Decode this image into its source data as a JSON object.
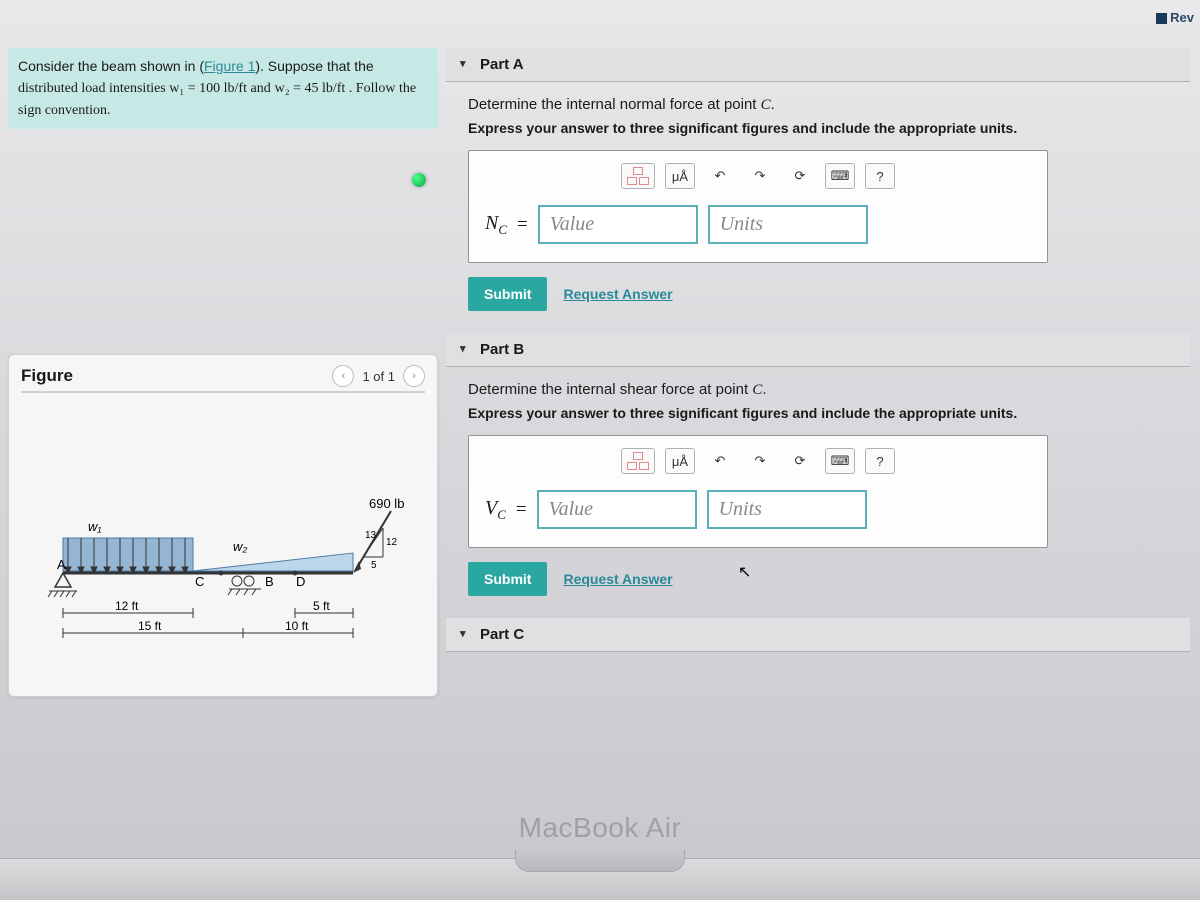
{
  "topbar": {
    "rev": "Rev"
  },
  "prompt": {
    "line1_pre": "Consider the beam shown in (",
    "figlink": "Figure 1",
    "line1_post": "). Suppose that the",
    "line2": "distributed load intensities w₁ = 100 lb/ft and",
    "line3": "w₂ = 45 lb/ft . Follow the sign convention."
  },
  "figure": {
    "title": "Figure",
    "counter": "1 of 1",
    "labels": {
      "w1": "w₁",
      "w2": "w₂",
      "load": "690 lb",
      "A": "A",
      "B": "B",
      "C": "C",
      "D": "D",
      "d12": "12 ft",
      "d15": "15 ft",
      "d5": "5 ft",
      "d10": "10 ft",
      "a13": "13",
      "a12": "12",
      "a5": "5"
    }
  },
  "parts": {
    "A": {
      "title": "Part A",
      "instr1": "Determine the internal normal force at point C.",
      "instr2": "Express your answer to three significant figures and include the appropriate units.",
      "var": "N",
      "sub": "C",
      "value_ph": "Value",
      "units_ph": "Units",
      "submit": "Submit",
      "request": "Request Answer"
    },
    "B": {
      "title": "Part B",
      "instr1": "Determine the internal shear force at point C.",
      "instr2": "Express your answer to three significant figures and include the appropriate units.",
      "var": "V",
      "sub": "C",
      "value_ph": "Value",
      "units_ph": "Units",
      "submit": "Submit",
      "request": "Request Answer"
    },
    "C": {
      "title": "Part C"
    }
  },
  "tools": {
    "mu": "μÅ",
    "help": "?"
  },
  "footer": {
    "brand": "MacBook Air"
  }
}
